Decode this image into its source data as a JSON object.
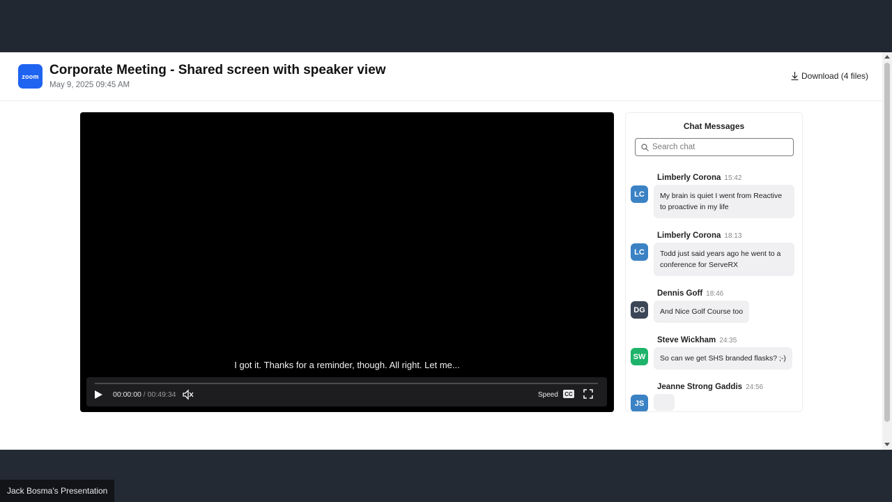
{
  "header": {
    "logo_text": "zoom",
    "title": "Corporate Meeting - Shared screen with speaker view",
    "date": "May 9, 2025 09:45 AM",
    "download_label": "Download (4 files)"
  },
  "player": {
    "caption": "I got it. Thanks for a reminder, though. All right. Let me...",
    "current_time": "00:00:00",
    "separator": "/",
    "duration": "00:49:34",
    "progress": 0,
    "speed_label": "Speed",
    "cc_label": "CC"
  },
  "chat": {
    "title": "Chat Messages",
    "search_placeholder": "Search chat",
    "messages": [
      {
        "initials": "LC",
        "name": "Limberly Corona",
        "time": "15:42",
        "text": "My brain is quiet I went from Reactive to proactive in my life",
        "color": "#3b82c4"
      },
      {
        "initials": "LC",
        "name": "Limberly Corona",
        "time": "18:13",
        "text": "Todd just said years ago he went to a conference for ServeRX",
        "color": "#3b82c4"
      },
      {
        "initials": "DG",
        "name": "Dennis Goff",
        "time": "18:46",
        "text": "And Nice Golf Course too",
        "color": "#3b4656"
      },
      {
        "initials": "SW",
        "name": "Steve Wickham",
        "time": "24:35",
        "text": "So can we get SHS branded flasks? ;-)",
        "color": "#1eb36a"
      },
      {
        "initials": "JS",
        "name": "Jeanne Strong Gaddis",
        "time": "24:56",
        "text": "",
        "color": "#3b82c4"
      }
    ]
  },
  "presenter_label": "Jack Bosma's Presentation",
  "colors": {
    "logo_blue": "#1f63f1",
    "video_bg": "#000000",
    "frame_bg": "#222831"
  }
}
